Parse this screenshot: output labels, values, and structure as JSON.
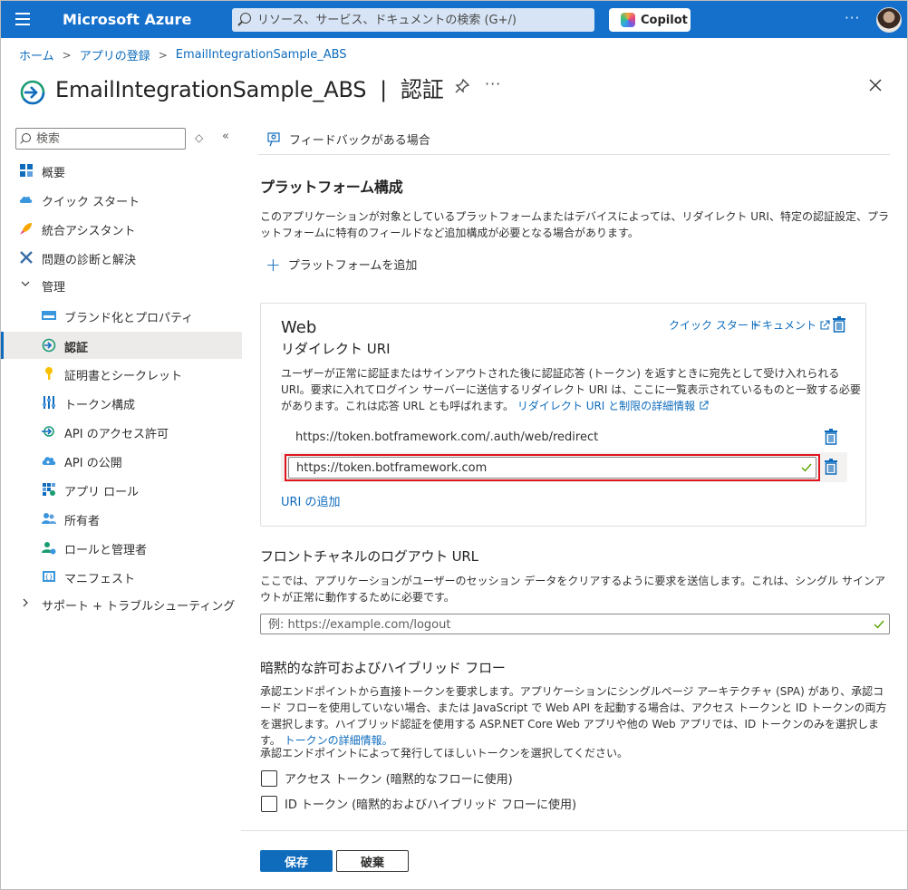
{
  "topbar": {
    "brand": "Microsoft Azure",
    "search_placeholder": "リソース、サービス、ドキュメントの検索 (G+/)",
    "copilot_label": "Copilot",
    "more": "···"
  },
  "breadcrumb": [
    "ホーム",
    "アプリの登録",
    "EmailIntegrationSample_ABS"
  ],
  "page": {
    "title": "EmailIntegrationSample_ABS  |  認証",
    "more": "···"
  },
  "sidebar": {
    "search_placeholder": "検索",
    "updown": "◇",
    "collapse": "«",
    "items": [
      {
        "label": "概要"
      },
      {
        "label": "クイック スタート"
      },
      {
        "label": "統合アシスタント"
      },
      {
        "label": "問題の診断と解決"
      },
      {
        "label": "管理"
      },
      {
        "label": "ブランド化とプロパティ"
      },
      {
        "label": "認証"
      },
      {
        "label": "証明書とシークレット"
      },
      {
        "label": "トークン構成"
      },
      {
        "label": "API のアクセス許可"
      },
      {
        "label": "API の公開"
      },
      {
        "label": "アプリ ロール"
      },
      {
        "label": "所有者"
      },
      {
        "label": "ロールと管理者"
      },
      {
        "label": "マニフェスト"
      },
      {
        "label": "サポート + トラブルシューティング"
      }
    ]
  },
  "main": {
    "feedback": "フィードバックがある場合",
    "platform_heading": "プラットフォーム構成",
    "platform_desc": "このアプリケーションが対象としているプラットフォームまたはデバイスによっては、リダイレクト URI、特定の認証設定、プラットフォームに特有のフィールドなど追加構成が必要となる場合があります。",
    "add_platform": "プラットフォームを追加",
    "web_card": {
      "title": "Web",
      "subtitle": "リダイレクト URI",
      "quick_start": "クイック スタート",
      "docs": "ドキュメント",
      "desc": "ユーザーが正常に認証またはサインアウトされた後に認証応答 (トークン) を返すときに宛先として受け入れられる URI。要求に入れてログイン サーバーに送信するリダイレクト URI は、ここに一覧表示されているものと一致する必要があります。これは応答 URL とも呼ばれます。",
      "desc_link": "リダイレクト URI と制限の詳細情報",
      "uri_1": "https://token.botframework.com/.auth/web/redirect",
      "uri_2": "https://token.botframework.com",
      "add_uri": "URI の追加"
    },
    "logout_heading": "フロントチャネルのログアウト URL",
    "logout_desc": "ここでは、アプリケーションがユーザーのセッション データをクリアするように要求を送信します。これは、シングル サインアウトが正常に動作するために必要です。",
    "logout_placeholder": "例: https://example.com/logout",
    "implicit_heading": "暗黙的な許可およびハイブリッド フロー",
    "implicit_desc": "承認エンドポイントから直接トークンを要求します。アプリケーションにシングルページ アーキテクチャ (SPA) があり、承認コード フローを使用していない場合、または JavaScript で Web API を起動する場合は、アクセス トークンと ID トークンの両方を選択します。ハイブリッド認証を使用する ASP.NET Core Web アプリや他の Web アプリでは、ID トークンのみを選択します。",
    "implicit_link": "トークンの詳細情報。",
    "token_prompt": "承認エンドポイントによって発行してほしいトークンを選択してください。",
    "checkbox_access": "アクセス トークン (暗黙的なフローに使用)",
    "checkbox_id": "ID トークン (暗黙的およびハイブリッド フローに使用)",
    "save": "保存",
    "discard": "破棄"
  },
  "colors": {
    "topbar": "#1570cc",
    "accent": "#0f6cbd",
    "highlight_border": "#e0161e",
    "valid_check": "#57a300"
  }
}
